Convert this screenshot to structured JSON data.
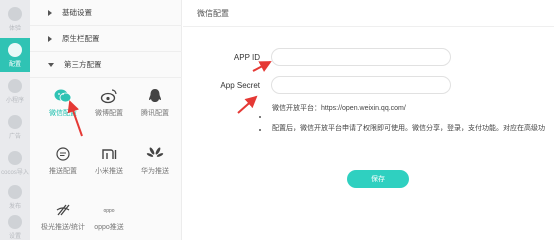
{
  "rail": {
    "items": [
      {
        "label": "体验",
        "active": false
      },
      {
        "label": "配置",
        "active": true
      },
      {
        "label": "小程序",
        "active": false
      },
      {
        "label": "广告",
        "active": false
      },
      {
        "label": "cocos导入",
        "active": false
      },
      {
        "label": "发布",
        "active": false
      },
      {
        "label": "设置",
        "active": false
      }
    ]
  },
  "sidebar": {
    "sections": [
      {
        "label": "基础设置",
        "expanded": false
      },
      {
        "label": "原生栏配置",
        "expanded": false
      },
      {
        "label": "第三方配置",
        "expanded": true
      }
    ],
    "items": [
      {
        "label": "微信配置",
        "icon": "wechat-icon",
        "selected": true
      },
      {
        "label": "微博配置",
        "icon": "weibo-icon",
        "selected": false
      },
      {
        "label": "腾讯配置",
        "icon": "qq-icon",
        "selected": false
      },
      {
        "label": "推送配置",
        "icon": "push-icon",
        "selected": false
      },
      {
        "label": "小米推送",
        "icon": "xiaomi-icon",
        "selected": false
      },
      {
        "label": "华为推送",
        "icon": "huawei-icon",
        "selected": false
      },
      {
        "label": "极光推送/统计",
        "icon": "jiguang-icon",
        "selected": false
      },
      {
        "label": "oppo推送",
        "icon": "oppo-icon",
        "selected": false
      }
    ]
  },
  "main": {
    "title": "微信配置",
    "fields": [
      {
        "label": "APP ID",
        "value": "",
        "placeholder": ""
      },
      {
        "label": "App Secret",
        "value": "",
        "placeholder": ""
      }
    ],
    "hint_platform": "微信开放平台：https://open.weixin.qq.com/",
    "hint_note": "配置后，微信开放平台申请了权限即可使用。微信分享，登录，支付功能。对应在高级功",
    "save_label": "保存"
  },
  "colors": {
    "accent": "#2fd0c0",
    "arrow": "#e53935"
  }
}
